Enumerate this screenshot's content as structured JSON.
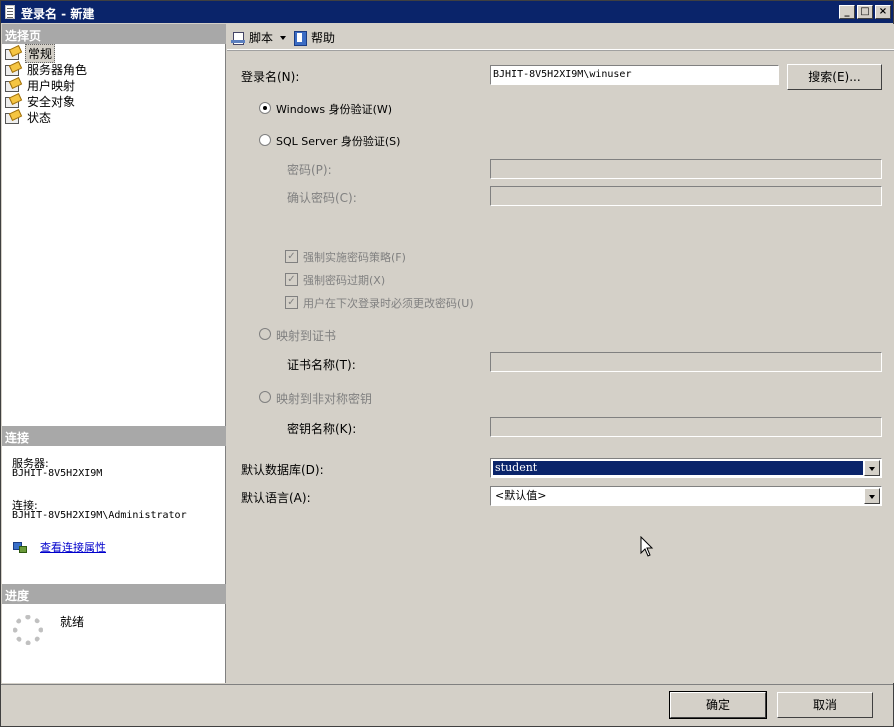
{
  "window": {
    "title": "登录名 - 新建",
    "minimize": "_",
    "maximize": "□",
    "close": "×"
  },
  "left": {
    "select_page_header": "选择页",
    "pages": [
      {
        "label": "常规",
        "icon": "page-icon",
        "selected": true
      },
      {
        "label": "服务器角色",
        "icon": "page-icon"
      },
      {
        "label": "用户映射",
        "icon": "page-icon"
      },
      {
        "label": "安全对象",
        "icon": "page-icon"
      },
      {
        "label": "状态",
        "icon": "page-icon"
      }
    ],
    "connection_header": "连接",
    "server_label": "服务器:",
    "server_value": "BJHIT-8V5H2XI9M",
    "connection_label": "连接:",
    "connection_value": "BJHIT-8V5H2XI9M\\Administrator",
    "view_properties_link": "查看连接属性",
    "progress_header": "进度",
    "progress_status": "就绪"
  },
  "toolbar": {
    "script_label": "脚本",
    "help_label": "帮助"
  },
  "form": {
    "login_name_label": "登录名(N):",
    "login_name_value": "BJHIT-8V5H2XI9M\\winuser",
    "search_button": "搜索(E)...",
    "windows_auth_label": "Windows 身份验证(W)",
    "sql_auth_label": "SQL Server 身份验证(S)",
    "password_label": "密码(P):",
    "confirm_password_label": "确认密码(C):",
    "enforce_policy_label": "强制实施密码策略(F)",
    "enforce_expiration_label": "强制密码过期(X)",
    "must_change_label": "用户在下次登录时必须更改密码(U)",
    "map_cert_label": "映射到证书",
    "cert_name_label": "证书名称(T):",
    "map_asym_key_label": "映射到非对称密钥",
    "key_name_label": "密钥名称(K):",
    "default_db_label": "默认数据库(D):",
    "default_db_value": "student",
    "default_lang_label": "默认语言(A):",
    "default_lang_value": "<默认值>"
  },
  "buttons": {
    "ok": "确定",
    "cancel": "取消"
  },
  "colors": {
    "titlebar": "#0a246a",
    "panel": "#d4d0c8",
    "section_header": "#a8a8a8",
    "link": "#0000cc"
  }
}
